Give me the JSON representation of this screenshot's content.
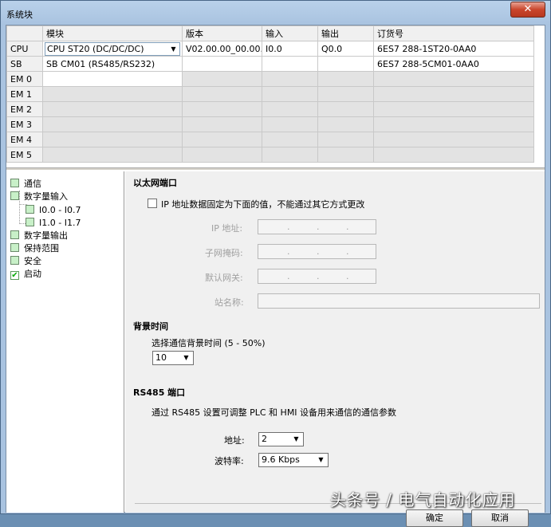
{
  "window": {
    "title": "系统块",
    "close_label": "✕"
  },
  "table": {
    "headers": [
      "",
      "模块",
      "版本",
      "输入",
      "输出",
      "订货号"
    ],
    "rows": [
      {
        "slot": "CPU",
        "module": "CPU ST20 (DC/DC/DC)",
        "version": "V02.00.00_00.00...",
        "input": "I0.0",
        "output": "Q0.0",
        "order": "6ES7 288-1ST20-0AA0"
      },
      {
        "slot": "SB",
        "module": "SB CM01 (RS485/RS232)",
        "version": "",
        "input": "",
        "output": "",
        "order": "6ES7 288-5CM01-0AA0"
      },
      {
        "slot": "EM 0",
        "module": "",
        "version": "",
        "input": "",
        "output": "",
        "order": ""
      },
      {
        "slot": "EM 1",
        "module": "",
        "version": "",
        "input": "",
        "output": "",
        "order": ""
      },
      {
        "slot": "EM 2",
        "module": "",
        "version": "",
        "input": "",
        "output": "",
        "order": ""
      },
      {
        "slot": "EM 3",
        "module": "",
        "version": "",
        "input": "",
        "output": "",
        "order": ""
      },
      {
        "slot": "EM 4",
        "module": "",
        "version": "",
        "input": "",
        "output": "",
        "order": ""
      },
      {
        "slot": "EM 5",
        "module": "",
        "version": "",
        "input": "",
        "output": "",
        "order": ""
      }
    ]
  },
  "tree": {
    "comm": "通信",
    "digital_in": "数字量输入",
    "range1": "I0.0 - I0.7",
    "range2": "I1.0 - I1.7",
    "digital_out": "数字量输出",
    "retentive": "保持范围",
    "security": "安全",
    "startup": "启动"
  },
  "ethernet": {
    "title": "以太网端口",
    "fixed_ip_label": "IP 地址数据固定为下面的值，不能通过其它方式更改",
    "ip_label": "IP 地址:",
    "subnet_label": "子网掩码:",
    "gateway_label": "默认网关:",
    "station_label": "站名称:",
    "dot": "."
  },
  "background": {
    "title": "背景时间",
    "select_label": "选择通信背景时间 (5 - 50%)",
    "value": "10"
  },
  "rs485": {
    "title": "RS485 端口",
    "description": "通过 RS485 设置可调整 PLC 和 HMI 设备用来通信的通信参数",
    "address_label": "地址:",
    "address_value": "2",
    "baud_label": "波特率:",
    "baud_value": "9.6 Kbps"
  },
  "buttons": {
    "ok": "确定",
    "cancel": "取消"
  },
  "watermark": "头条号 / 电气自动化应用"
}
